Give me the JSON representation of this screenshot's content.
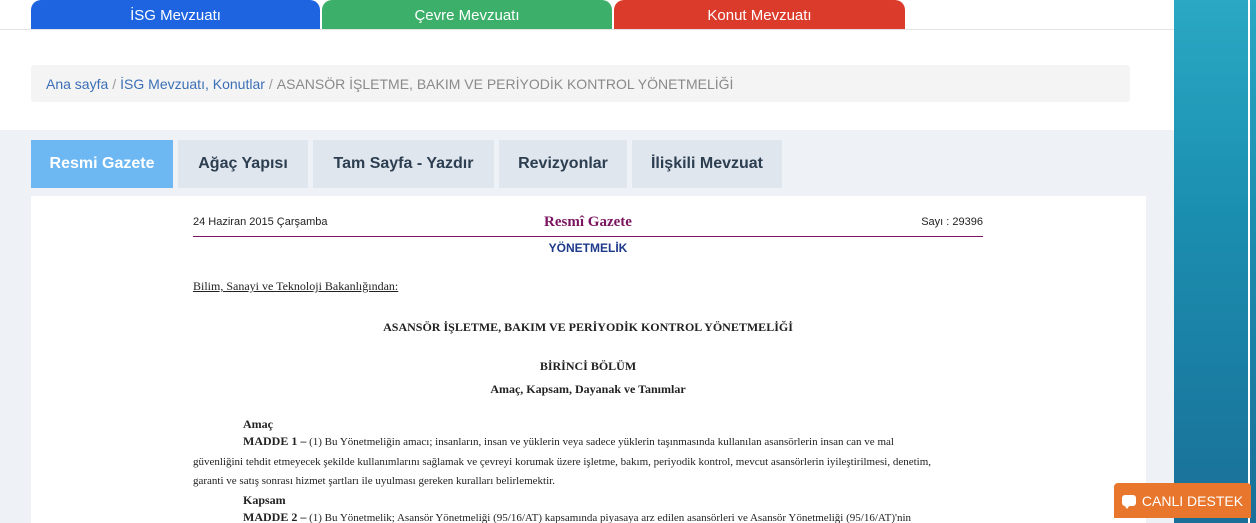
{
  "top_tabs": [
    {
      "label": "İSG Mevzuatı"
    },
    {
      "label": "Çevre Mevzuatı"
    },
    {
      "label": "Konut Mevzuatı"
    }
  ],
  "breadcrumb": {
    "home": "Ana sayfa",
    "category": "İSG Mevzuatı, Konutlar",
    "current": "ASANSÖR İŞLETME, BAKIM VE PERİYODİK KONTROL YÖNETMELİĞİ"
  },
  "doc_tabs": [
    {
      "label": "Resmi Gazete"
    },
    {
      "label": "Ağaç Yapısı"
    },
    {
      "label": "Tam Sayfa - Yazdır"
    },
    {
      "label": "Revizyonlar"
    },
    {
      "label": "İlişkili Mevzuat"
    }
  ],
  "document": {
    "date": "24 Haziran 2015 Çarşamba",
    "gazette": "Resmî Gazete",
    "issue": "Sayı : 29396",
    "type": "YÖNETMELİK",
    "ministry": "Bilim, Sanayi ve Teknoloji Bakanlığından:",
    "title": "ASANSÖR İŞLETME, BAKIM VE PERİYODİK KONTROL YÖNETMELİĞİ",
    "part": "BİRİNCİ BÖLÜM",
    "part_sub": "Amaç, Kapsam, Dayanak ve Tanımlar",
    "section1": "Amaç",
    "article1_label": "MADDE 1 –",
    "article1_line1": " (1) Bu Yönetmeliğin amacı; insanların, insan ve yüklerin veya sadece yüklerin taşınmasında kullanılan asansörlerin insan can ve mal",
    "article1_line2": "güvenliğini tehdit etmeyecek şekilde kullanımlarını sağlamak ve çevreyi korumak üzere işletme, bakım, periyodik kontrol, mevcut asansörlerin iyileştirilmesi, denetim,",
    "article1_line3": "garanti ve satış sonrası hizmet şartları ile uyulması gereken kuralları belirlemektir.",
    "section2": "Kapsam",
    "article2_label": "MADDE 2 –",
    "article2_line1": " (1) Bu Yönetmelik; Asansör Yönetmeliği (95/16/AT) kapsamında piyasaya arz edilen asansörleri ve Asansör Yönetmeliği (95/16/AT)'nin"
  },
  "chat": {
    "label": "CANLI DESTEK",
    "icon": "chat-bubbles-icon"
  },
  "colors": {
    "isg_tab": "#1e64e0",
    "cevre_tab": "#3cb06a",
    "konut_tab": "#db3b2b",
    "active_doc_tab": "#6db7f2",
    "chat_button": "#e8762c",
    "gazette_title": "#7b1560"
  }
}
